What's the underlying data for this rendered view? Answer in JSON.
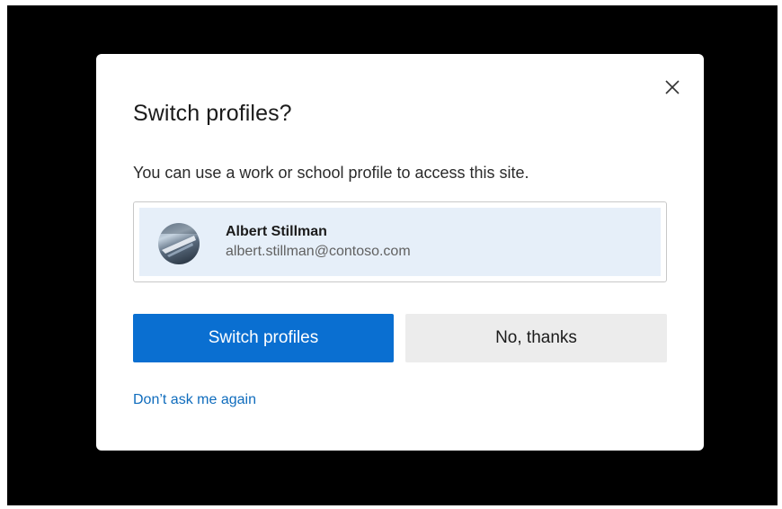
{
  "dialog": {
    "title": "Switch profiles?",
    "message": "You can use a work or school profile to access this site.",
    "close_icon": "close-icon",
    "profile": {
      "name": "Albert Stillman",
      "email": "albert.stillman@contoso.com",
      "avatar_icon": "avatar"
    },
    "primary_button_label": "Switch profiles",
    "secondary_button_label": "No, thanks",
    "dont_ask_link": "Don’t ask me again"
  },
  "colors": {
    "backdrop": "#000000",
    "primary": "#0a6fd1",
    "secondary_button": "#ececec",
    "selected_profile_bg": "#e6eff9",
    "link": "#0f6cbd"
  }
}
